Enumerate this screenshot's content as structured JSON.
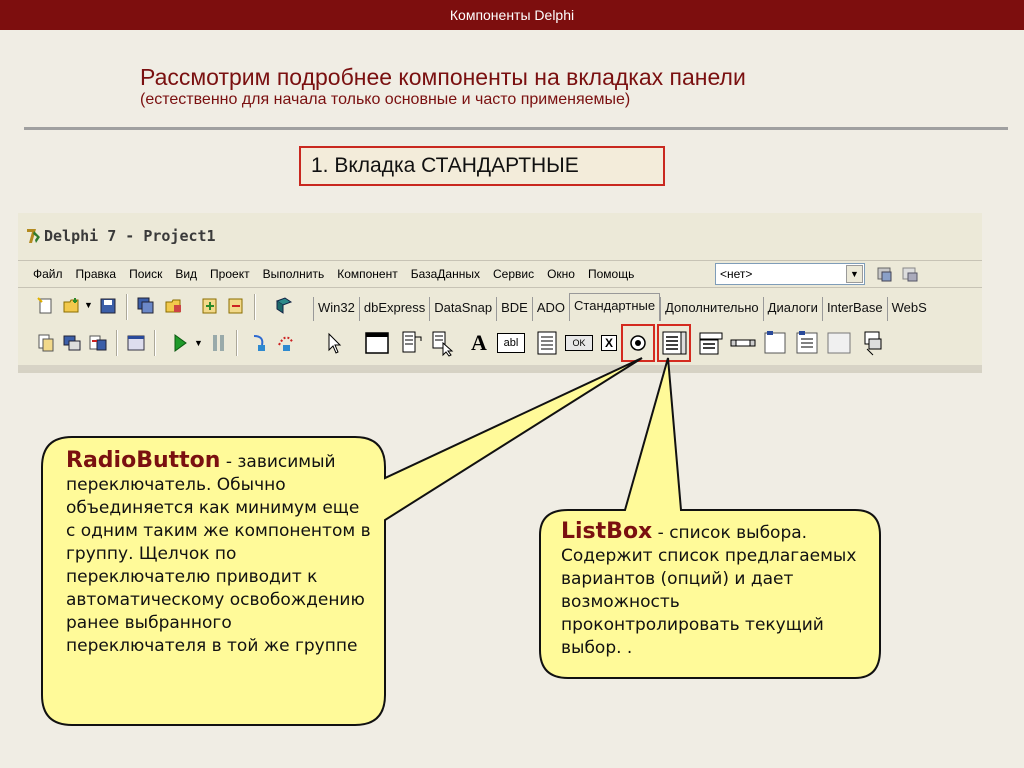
{
  "slide": {
    "header": "Компоненты Delphi",
    "title": "Рассмотрим подробнее компоненты на вкладках панели",
    "subtitle": "(естественно для начала только основные и часто применяемые)",
    "section_label": "1. Вкладка СТАНДАРТНЫЕ"
  },
  "window": {
    "title": "Delphi 7 - Project1",
    "menu": [
      "Файл",
      "Правка",
      "Поиск",
      "Вид",
      "Проект",
      "Выполнить",
      "Компонент",
      "БазаДанных",
      "Сервис",
      "Окно",
      "Помощь"
    ],
    "combo_value": "<нет>",
    "tabs": [
      "Win32",
      "dbExpress",
      "DataSnap",
      "BDE",
      "ADO",
      "Стандартные",
      "Дополнительно",
      "Диалоги",
      "InterBase",
      "WebS"
    ],
    "active_tab": "Стандартные",
    "palette_labels": {
      "label_a": "A",
      "edit": "abl",
      "button": "OK",
      "checkbox": "X"
    }
  },
  "callouts": {
    "radiobutton": {
      "term": "RadioButton",
      "text": " - зависимый переключатель. Обычно объединяется как минимум еще с одним таким же компонентом в группу. Щелчок по переключателю приводит к автоматическому освобождению ранее выбранного переключателя в той же группе"
    },
    "listbox": {
      "term": "ListBox",
      "text": " - список выбора. Содержит список предлагаемых вариантов (опций) и дает возможность проконтролировать текущий выбор. ."
    }
  },
  "colors": {
    "header_bar": "#7d0e0e",
    "title_text": "#7a1010",
    "highlight_border": "#d42a1f",
    "callout_fill": "#fffa99",
    "window_bg": "#ece9d8"
  }
}
